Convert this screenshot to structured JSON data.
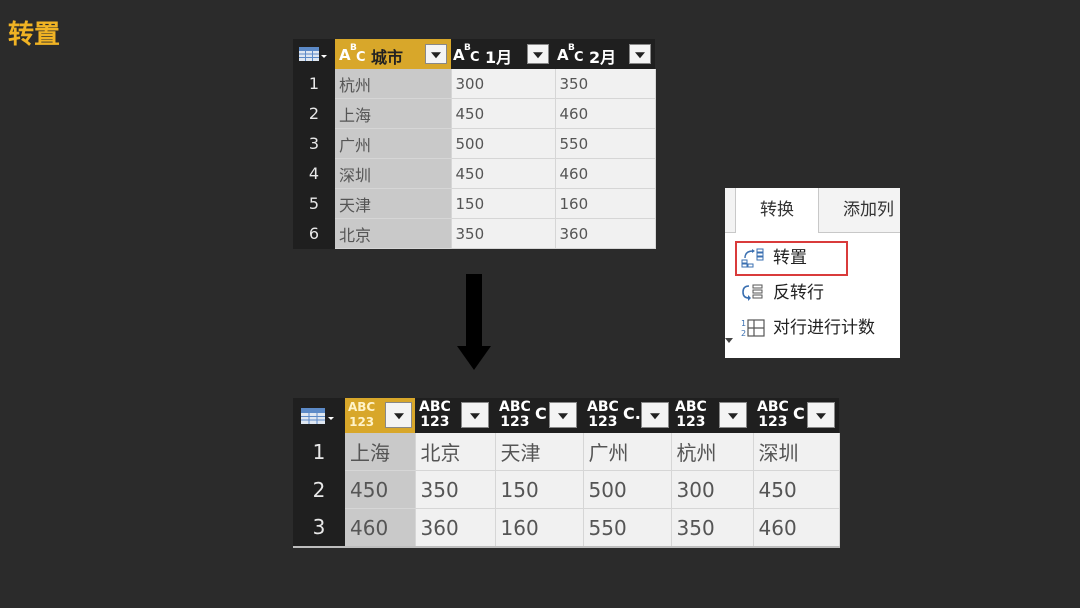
{
  "slide": {
    "title": "转置"
  },
  "top_table": {
    "headers": [
      {
        "type_icon": "ABC",
        "label": "城市",
        "selected": true
      },
      {
        "type_icon": "ABC",
        "label": "1月",
        "selected": false
      },
      {
        "type_icon": "ABC",
        "label": "2月",
        "selected": false
      }
    ],
    "rows": [
      {
        "num": "1",
        "cells": [
          "杭州",
          "300",
          "350"
        ]
      },
      {
        "num": "2",
        "cells": [
          "上海",
          "450",
          "460"
        ]
      },
      {
        "num": "3",
        "cells": [
          "广州",
          "500",
          "550"
        ]
      },
      {
        "num": "4",
        "cells": [
          "深圳",
          "450",
          "460"
        ]
      },
      {
        "num": "5",
        "cells": [
          "天津",
          "150",
          "160"
        ]
      },
      {
        "num": "6",
        "cells": [
          "北京",
          "350",
          "360"
        ]
      }
    ]
  },
  "bottom_table": {
    "headers": [
      {
        "type_icon": "ABC 123",
        "label_fragment": "",
        "selected": true
      },
      {
        "type_icon": "ABC 123",
        "label_fragment": "",
        "selected": false
      },
      {
        "type_icon": "ABC 123",
        "label_fragment": "C",
        "selected": false
      },
      {
        "type_icon": "ABC 123",
        "label_fragment": "C.",
        "selected": false
      },
      {
        "type_icon": "ABC 123",
        "label_fragment": "",
        "selected": false
      },
      {
        "type_icon": "ABC 123",
        "label_fragment": "C",
        "selected": false
      }
    ],
    "rows": [
      {
        "num": "1",
        "cells": [
          "上海",
          "北京",
          "天津",
          "广州",
          "杭州",
          "深圳"
        ]
      },
      {
        "num": "2",
        "cells": [
          "450",
          "350",
          "150",
          "500",
          "300",
          "450"
        ]
      },
      {
        "num": "3",
        "cells": [
          "460",
          "360",
          "160",
          "550",
          "350",
          "460"
        ]
      }
    ]
  },
  "ribbon": {
    "tabs": [
      {
        "label": "转换",
        "active": true
      },
      {
        "label": "添加列",
        "active": false
      }
    ],
    "items": [
      {
        "label": "转置",
        "icon": "transpose-icon",
        "highlighted": true
      },
      {
        "label": "反转行",
        "icon": "reverse-rows-icon",
        "highlighted": false
      },
      {
        "label": "对行进行计数",
        "icon": "count-rows-icon",
        "highlighted": false
      }
    ],
    "highlight_color": "#d93b3b"
  },
  "colors": {
    "background": "#2b2b2b",
    "title": "#f0b324",
    "selected_header": "#d8a72a",
    "header_bg": "#1f1f1f",
    "cell_bg": "#f1f1f1",
    "selected_cell_bg": "#c9c9c9"
  }
}
